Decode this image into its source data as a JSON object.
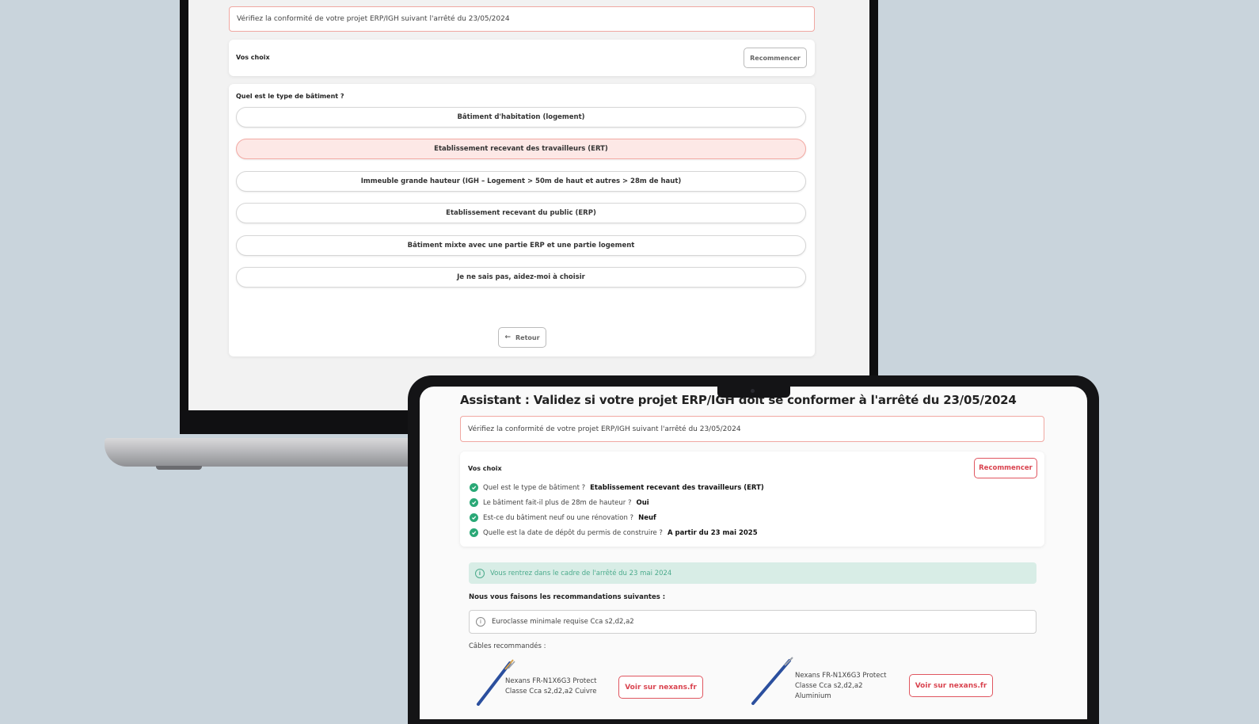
{
  "laptop": {
    "notice": "Vérifiez la conformité de votre projet ERP/IGH suivant l'arrêté du 23/05/2024",
    "choices_title": "Vos choix",
    "restart_label": "Recommencer",
    "question": "Quel est le type de bâtiment ?",
    "options": [
      "Bâtiment d'habitation (logement)",
      "Etablissement recevant des travailleurs (ERT)",
      "Immeuble grande hauteur (IGH – Logement > 50m de haut et autres > 28m de haut)",
      "Etablissement recevant du public (ERP)",
      "Bâtiment mixte avec une partie ERP et une partie logement",
      "Je ne sais pas, aidez-moi à choisir"
    ],
    "selected_option": "Etablissement recevant des travailleurs (ERT)",
    "back_label": "Retour",
    "back_icon": "arrow-left-icon"
  },
  "tablet": {
    "title": "Assistant : Validez si votre projet ERP/IGH doit se conformer à l'arrêté du 23/05/2024",
    "notice": "Vérifiez la conformité de votre projet ERP/IGH suivant l'arrêté du 23/05/2024",
    "choices_title": "Vos choix",
    "restart_label": "Recommencer",
    "answers": [
      {
        "question": "Quel est le type de bâtiment ?",
        "answer": "Etablissement recevant des travailleurs (ERT)"
      },
      {
        "question": "Le bâtiment fait-il plus de 28m de hauteur ?",
        "answer": "Oui"
      },
      {
        "question": "Est-ce du bâtiment neuf ou une rénovation ?",
        "answer": "Neuf"
      },
      {
        "question": "Quelle est la date de dépôt du permis de construire ?",
        "answer": "A partir du 23 mai 2025"
      }
    ],
    "status_message": "Vous rentrez dans le cadre de l'arrêté du 23 mai 2024",
    "recommendations_title": "Nous vous faisons les recommandations suivantes :",
    "euroclass": "Euroclasse minimale requise Cca s2,d2,a2",
    "cables_title": "Câbles recommandés :",
    "cables": [
      {
        "line1": "Nexans FR-N1X6G3 Protect",
        "line2": "Classe Cca s2,d2,a2 Cuivre",
        "line3": "",
        "link": "Voir sur nexans.fr"
      },
      {
        "line1": "Nexans FR-N1X6G3 Protect",
        "line2": "Classe Cca s2,d2,a2",
        "line3": "Aluminium",
        "link": "Voir sur nexans.fr"
      }
    ]
  },
  "colors": {
    "background": "#c9d4dc",
    "accent_red": "#d9434f",
    "selected_bg": "#fde8e6",
    "success_green": "#2aa876",
    "status_bg": "#d8ede6"
  }
}
